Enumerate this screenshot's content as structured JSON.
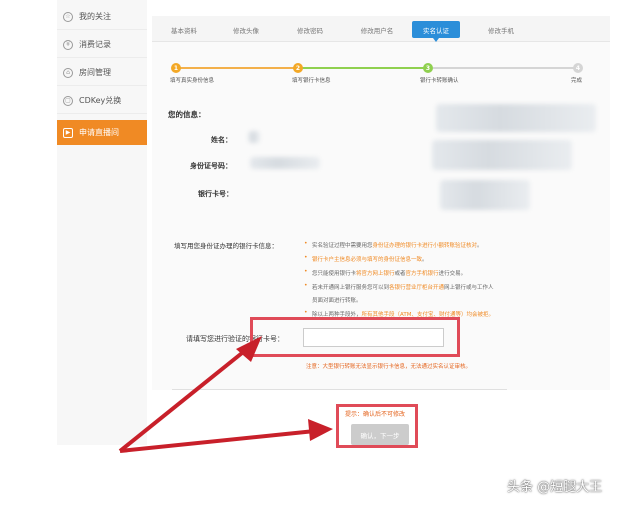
{
  "sidebar": {
    "items": [
      {
        "icon": "star-icon",
        "label": "我的关注"
      },
      {
        "icon": "yen-icon",
        "label": "消费记录"
      },
      {
        "icon": "room-icon",
        "label": "房间管理"
      },
      {
        "icon": "cdkey-icon",
        "label": "CDKey兑换"
      },
      {
        "icon": "live-icon",
        "label": "申请直播间"
      }
    ],
    "active_index": 4
  },
  "tabs": [
    {
      "label": "基本资料"
    },
    {
      "label": "修改头像"
    },
    {
      "label": "修改密码"
    },
    {
      "label": "修改用户名"
    },
    {
      "label": "实名认证"
    },
    {
      "label": "修改手机"
    }
  ],
  "active_tab": 4,
  "steps": [
    {
      "num": "1",
      "label": "填写真实身份信息",
      "state": "done"
    },
    {
      "num": "2",
      "label": "填写银行卡信息",
      "state": "current"
    },
    {
      "num": "3",
      "label": "银行卡转账确认",
      "state": "todo"
    },
    {
      "num": "4",
      "label": "完成",
      "state": "todo"
    }
  ],
  "info": {
    "title": "您的信息：",
    "name_label": "姓名：",
    "id_label": "身份证号码：",
    "card_label": "银行卡号："
  },
  "tips": {
    "heading": "填写用您身份证办理的银行卡信息：",
    "lines": [
      {
        "pre": "实名验证过程中需要用您",
        "hl": "身份证办理的银行卡进行小额转账验证核对",
        "post": "。"
      },
      {
        "pre": "",
        "hl": "银行卡户主信息必须与填写的身份证信息一致",
        "post": "。"
      },
      {
        "pre": "您只能使用银行卡",
        "hl": "将官方网上银行",
        "post": "或者",
        "hl2": "官方手机银行",
        "post2": "进行交易。"
      },
      {
        "pre": "若未开通网上银行服务您可以到",
        "hl": "各银行营业厅柜台开通",
        "post": "网上银行或与工作人"
      },
      {
        "pre": "员面对面进行转账。",
        "hl": "",
        "post": ""
      },
      {
        "pre": "除以上两种手段外，",
        "hl": "所有其他手段（ATM、支付宝、财付通等）均会被拒。",
        "post": ""
      }
    ]
  },
  "card_input": {
    "label": "请填写您进行验证的银行卡号：",
    "value": "",
    "note": "注意：大型银行转账无法显示银行卡信息，无法通过实名认证审核。"
  },
  "warning": "提示：确认后不可修改",
  "next_button": "确认，下一步",
  "watermark": "头条 @短腿大王",
  "colors": {
    "accent_orange": "#f08a24",
    "tab_blue": "#2b8ed9",
    "highlight_red": "#e04b58",
    "arrow_red": "#c8202a"
  }
}
